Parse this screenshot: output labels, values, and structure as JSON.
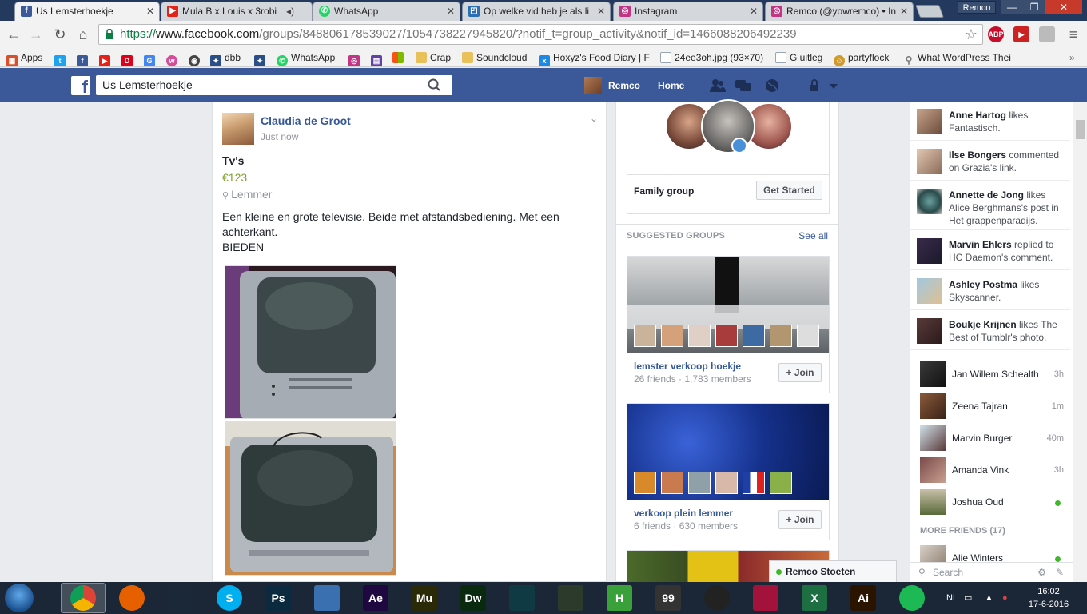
{
  "browser": {
    "tabs": [
      {
        "title": "Us Lemsterhoekje",
        "icon": "f",
        "color": "#3b5998",
        "active": true
      },
      {
        "title": "Mula B x Louis x 3robi",
        "icon": "youtube-icon",
        "color": "#e62117"
      },
      {
        "title": "WhatsApp",
        "icon": "whatsapp-icon",
        "color": "#25d366"
      },
      {
        "title": "Op welke vid heb je als li",
        "icon": "page-icon",
        "color": "#2a6fb6"
      },
      {
        "title": "Instagram",
        "icon": "instagram-icon",
        "color": "#c13584"
      },
      {
        "title": "Remco (@yowremco) • In",
        "icon": "instagram-icon",
        "color": "#c13584"
      }
    ],
    "profile": "Remco",
    "url": {
      "scheme": "https://",
      "host": "www.facebook.com",
      "path": "/groups/848806178539027/1054738227945820/?notif_t=group_activity&notif_id=1466088206492239"
    },
    "bookmarks": [
      {
        "label": "Apps",
        "icon": "apps-icon",
        "color": "#d94f2b"
      },
      {
        "label": "",
        "icon": "twitter-icon",
        "color": "#1da1f2"
      },
      {
        "label": "",
        "icon": "facebook-icon",
        "color": "#3b5998"
      },
      {
        "label": "",
        "icon": "youtube-icon",
        "color": "#e62117"
      },
      {
        "label": "",
        "icon": "dumpert-icon",
        "color": "#e0001b"
      },
      {
        "label": "",
        "icon": "google-icon",
        "color": "#4285f4"
      },
      {
        "label": "",
        "icon": "wattpad-icon",
        "color": "#d44c9a"
      },
      {
        "label": "",
        "icon": "racing-icon",
        "color": "#444444"
      },
      {
        "label": "dbb",
        "icon": "dbb-icon",
        "color": "#2a4f86"
      },
      {
        "label": "",
        "icon": "dbb-icon",
        "color": "#2a4f86"
      },
      {
        "label": "WhatsApp",
        "icon": "whatsapp-icon",
        "color": "#25d366"
      },
      {
        "label": "",
        "icon": "instagram-icon",
        "color": "#c13584"
      },
      {
        "label": "",
        "icon": "twitch-icon",
        "color": "#6441a5"
      },
      {
        "label": "",
        "icon": "windows-icon",
        "color": "#00a1f1"
      },
      {
        "label": "Crap",
        "icon": "folder-icon",
        "color": "#e8c15a"
      },
      {
        "label": "Soundcloud",
        "icon": "folder-icon",
        "color": "#e8c15a"
      },
      {
        "label": "Hoxyz's Food Diary | F",
        "icon": "hoxyz-icon",
        "color": "#1e88e5"
      },
      {
        "label": "24ee3oh.jpg (93×70)",
        "icon": "file-icon",
        "color": "#9aa5b4"
      },
      {
        "label": "G uitleg",
        "icon": "file-icon",
        "color": "#9aa5b4"
      },
      {
        "label": "partyflock",
        "icon": "partyflock-icon",
        "color": "#d19a2a"
      },
      {
        "label": "What WordPress Thei",
        "icon": "search-icon",
        "color": "#777777"
      }
    ]
  },
  "facebook": {
    "search_value": "Us Lemsterhoekje",
    "user_name": "Remco",
    "home_label": "Home",
    "post": {
      "author": "Claudia de Groot",
      "time": "Just now",
      "title": "Tv's",
      "price": "€123",
      "location": "Lemmer",
      "body": "Een kleine en grote televisie. Beide met afstandsbediening. Met een\nachterkant.\nBIEDEN"
    },
    "family": {
      "label": "Family group",
      "button": "Get Started"
    },
    "suggested": {
      "heading": "SUGGESTED GROUPS",
      "see_all": "See all",
      "groups": [
        {
          "name": "lemster verkoop hoekje",
          "meta": "26 friends · 1,783 members",
          "button": "+ Join"
        },
        {
          "name": "verkoop plein lemmer",
          "meta": "6 friends · 630 members",
          "button": "+ Join"
        }
      ]
    },
    "ticker": [
      {
        "name": "Anne Hartog",
        "text": " likes Fantastisch."
      },
      {
        "name": "Ilse Bongers",
        "text": " commented on Grazia's link."
      },
      {
        "name": "Annette de Jong",
        "text": " likes Alice Berghmans's post in Het grappenparadijs."
      },
      {
        "name": "Marvin Ehlers",
        "text": " replied to HC Daemon's comment."
      },
      {
        "name": "Ashley Postma",
        "text": " likes Skyscanner."
      },
      {
        "name": "Boukje Krijnen",
        "text": " likes The Best of Tumblr's photo."
      }
    ],
    "chat": [
      {
        "name": "Jan Willem Schealth",
        "time": "3h"
      },
      {
        "name": "Zeena Tajran",
        "time": "1m"
      },
      {
        "name": "Marvin Burger",
        "time": "40m"
      },
      {
        "name": "Amanda Vink",
        "time": "3h"
      },
      {
        "name": "Joshua Oud",
        "time": ""
      }
    ],
    "more_friends": "MORE FRIENDS (17)",
    "next_friend": "Alie Winters",
    "chat_search_placeholder": "Search",
    "open_chat": "Remco Stoeten"
  },
  "taskbar": {
    "apps": [
      {
        "label": "",
        "icon": "chrome-icon",
        "color": "#dd4b39"
      },
      {
        "label": "",
        "icon": "firefox-icon",
        "color": "#e66000"
      },
      {
        "label": "",
        "icon": "steam-icon",
        "color": "#1b2838"
      },
      {
        "label": "S",
        "icon": "skype-icon",
        "color": "#00aff0"
      },
      {
        "label": "Ps",
        "icon": "photoshop-icon",
        "color": "#0b2a3f"
      },
      {
        "label": "",
        "icon": "keyboard-icon",
        "color": "#3a6fb0"
      },
      {
        "label": "Ae",
        "icon": "aftereffects-icon",
        "color": "#1f0740"
      },
      {
        "label": "Mu",
        "icon": "muse-icon",
        "color": "#2a2a08"
      },
      {
        "label": "Dw",
        "icon": "dreamweaver-icon",
        "color": "#0a2a10"
      },
      {
        "label": "",
        "icon": "film-icon",
        "color": "#0f3a44"
      },
      {
        "label": "",
        "icon": "fl-studio-icon",
        "color": "#2b3a2b"
      },
      {
        "label": "H",
        "icon": "h-app-icon",
        "color": "#3aa03a"
      },
      {
        "label": "99",
        "icon": "monitor-icon",
        "color": "#333333"
      },
      {
        "label": "",
        "icon": "circle-app-icon",
        "color": "#222222"
      },
      {
        "label": "",
        "icon": "game-icon",
        "color": "#a3123a"
      },
      {
        "label": "X",
        "icon": "excel-icon",
        "color": "#1d6f42"
      },
      {
        "label": "Ai",
        "icon": "illustrator-icon",
        "color": "#2a1400"
      },
      {
        "label": "",
        "icon": "spotify-icon",
        "color": "#1db954"
      }
    ],
    "language": "NL",
    "time": "16:02",
    "date": "17-6-2016"
  }
}
